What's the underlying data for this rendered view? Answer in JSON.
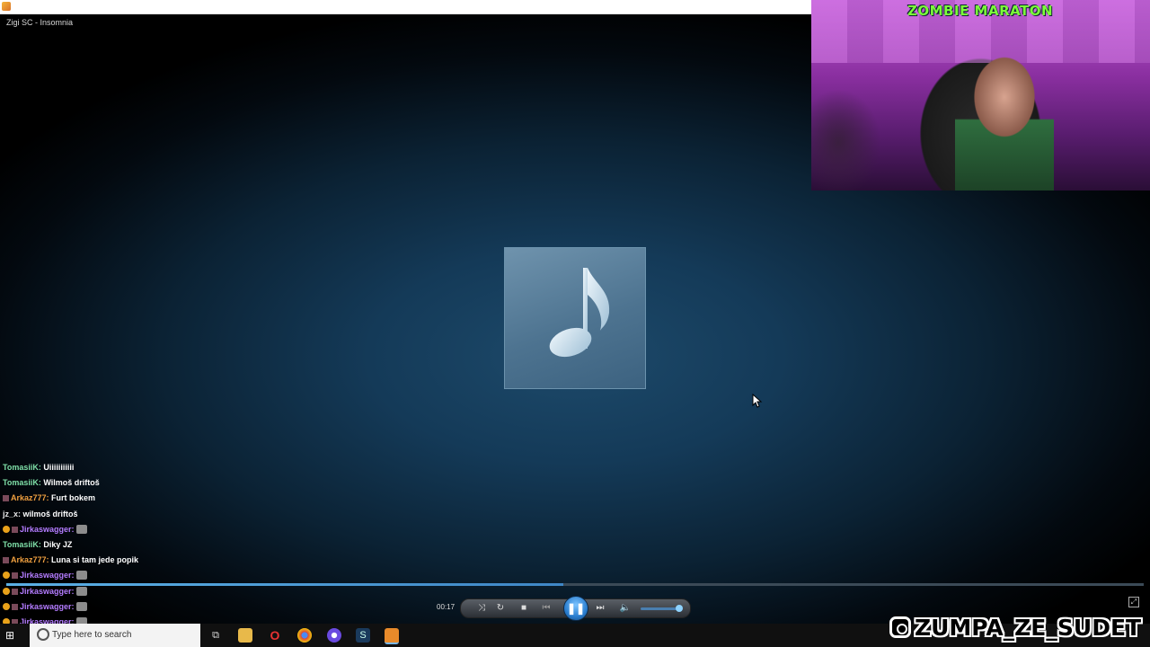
{
  "window": {
    "title": "Zigi SC - Insomnia"
  },
  "stream": {
    "title": "ZOMBIE MARATON",
    "instagram": "ZUMPA_ZE_SUDET"
  },
  "player": {
    "elapsed": "00:17",
    "progress": 0.49,
    "volume": 0.85,
    "play_state_icon": "pause-icon"
  },
  "chat": [
    {
      "user": "TomasiiK",
      "color": "#7fe0a8",
      "msg": "Uiiiiiiiiiii",
      "badges": [],
      "emote": false
    },
    {
      "user": "TomasiiK",
      "color": "#7fe0a8",
      "msg": "Wilmoš driftoš",
      "badges": [],
      "emote": false
    },
    {
      "user": "Arkaz777",
      "color": "#f0a040",
      "msg": "Furt bokem",
      "badges": [
        "b2"
      ],
      "emote": false
    },
    {
      "user": "jz_x",
      "color": "#e8e8e8",
      "msg": "wilmoš driftoš",
      "badges": [],
      "emote": false
    },
    {
      "user": "Jirkaswagger",
      "color": "#b47cff",
      "msg": "",
      "badges": [
        "b1",
        "b2"
      ],
      "emote": true
    },
    {
      "user": "TomasiiK",
      "color": "#7fe0a8",
      "msg": "Diky JZ",
      "badges": [],
      "emote": false
    },
    {
      "user": "Arkaz777",
      "color": "#f0a040",
      "msg": "Luna si tam jede popik",
      "badges": [
        "b2"
      ],
      "emote": false
    },
    {
      "user": "Jirkaswagger",
      "color": "#b47cff",
      "msg": "",
      "badges": [
        "b1",
        "b2"
      ],
      "emote": true
    },
    {
      "user": "Jirkaswagger",
      "color": "#b47cff",
      "msg": "",
      "badges": [
        "b1",
        "b2"
      ],
      "emote": true
    },
    {
      "user": "Jirkaswagger",
      "color": "#b47cff",
      "msg": "",
      "badges": [
        "b1",
        "b2"
      ],
      "emote": true
    },
    {
      "user": "Jirkaswagger",
      "color": "#b47cff",
      "msg": "",
      "badges": [
        "b1",
        "b2"
      ],
      "emote": true
    }
  ],
  "taskbar": {
    "search_placeholder": "Type here to search",
    "icons": [
      "windows-start-icon",
      "task-view-icon",
      "file-explorer-icon",
      "opera-icon",
      "chrome-icon",
      "app-icon",
      "steam-icon",
      "media-player-icon"
    ]
  },
  "colors": {
    "accent": "#3f87c6",
    "stream_title": "#7cff3a"
  }
}
